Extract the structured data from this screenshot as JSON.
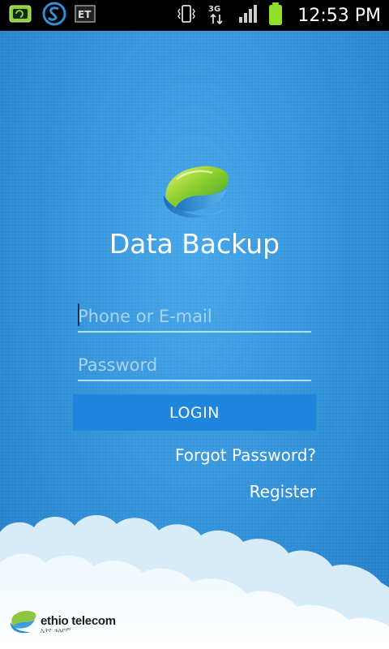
{
  "status_bar": {
    "time": "12:53 PM",
    "notification_icons": [
      "screen-mirror-icon",
      "s-app-icon",
      "et-app-icon"
    ],
    "network_type": "3G",
    "colors": {
      "battery": "#8ee02a",
      "background": "#000000"
    }
  },
  "app": {
    "title": "Data Backup",
    "logo_icon": "data-backup-logo-icon"
  },
  "form": {
    "phone_placeholder": "Phone or E-mail",
    "password_placeholder": "Password",
    "login_label": "LOGIN",
    "forgot_password_label": "Forgot Password?",
    "register_label": "Register"
  },
  "footer": {
    "brand_name": "ethio telecom",
    "brand_subtitle": "ኢትዮ ቴሌኮም"
  },
  "colors": {
    "background": "#2f8fd7",
    "button": "#1e86dd",
    "input_underline": "#a9e3f2",
    "placeholder": "#a9d3f0"
  }
}
